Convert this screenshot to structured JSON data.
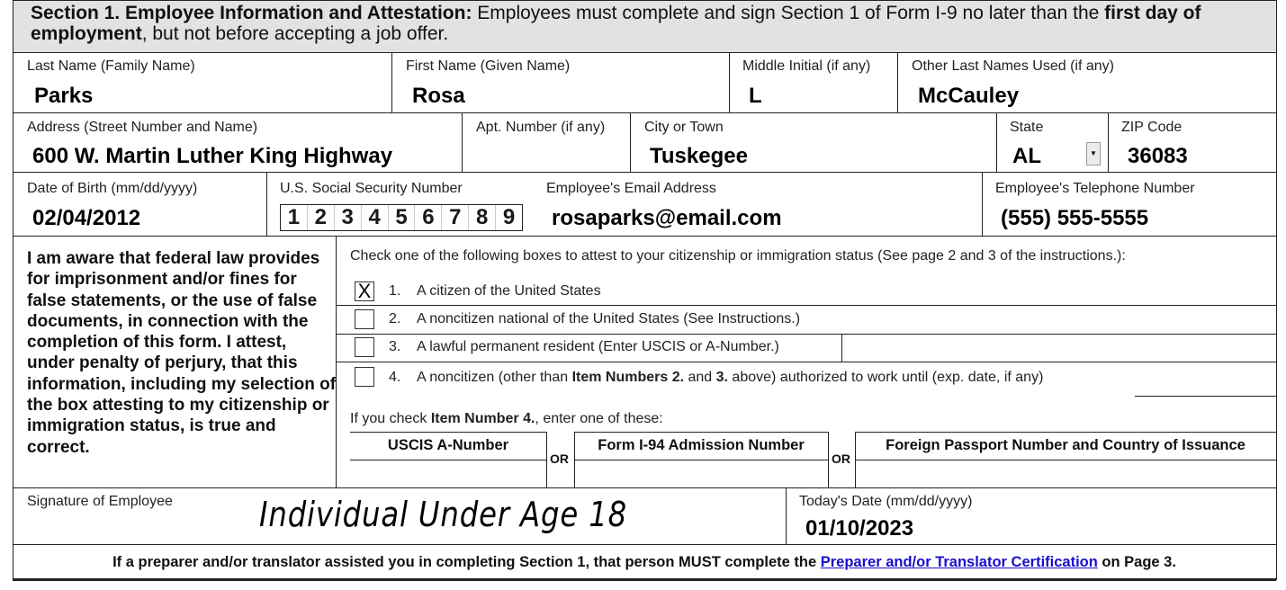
{
  "header": {
    "section_label": "Section 1. Employee Information and Attestation:",
    "text_pre": " Employees must complete and sign Section 1 of Form I-9 no later than the ",
    "bold_first": "first day of employment",
    "text_post": ", but not before accepting a job offer."
  },
  "fields": {
    "last_name": {
      "label": "Last Name (Family Name)",
      "value": "Parks"
    },
    "first_name": {
      "label": "First Name (Given Name)",
      "value": "Rosa"
    },
    "middle_initial": {
      "label": "Middle Initial (if any)",
      "value": "L"
    },
    "other_last_names": {
      "label": "Other Last Names Used (if any)",
      "value": "McCauley"
    },
    "address": {
      "label": "Address (Street Number and Name)",
      "value": "600 W. Martin Luther King Highway"
    },
    "apt_number": {
      "label": "Apt. Number (if any)",
      "value": ""
    },
    "city": {
      "label": "City or Town",
      "value": "Tuskegee"
    },
    "state": {
      "label": "State",
      "value": "AL",
      "dropdown_icon": "chevron-down-icon"
    },
    "zip": {
      "label": "ZIP Code",
      "value": "36083"
    },
    "dob": {
      "label": "Date of Birth (mm/dd/yyyy)",
      "value": "02/04/2012"
    },
    "ssn": {
      "label": "U.S. Social Security Number",
      "digits": [
        "1",
        "2",
        "3",
        "4",
        "5",
        "6",
        "7",
        "8",
        "9"
      ]
    },
    "email": {
      "label": "Employee's Email Address",
      "value": "rosaparks@email.com"
    },
    "phone": {
      "label": "Employee's Telephone Number",
      "value": "(555) 555-5555"
    }
  },
  "attestation": {
    "text": "I am aware that federal law provides for imprisonment and/or fines for false statements, or the use of false documents, in connection with the completion of this form.  I attest, under penalty of perjury, that this information, including my selection of the box attesting to my citizenship or immigration status, is true and correct.",
    "instruction": "Check one of the following boxes to attest to your citizenship or immigration status (See page 2 and 3 of the instructions.):",
    "options": [
      {
        "num": "1.",
        "text": "A citizen of the United States",
        "checked": true,
        "mark": "X"
      },
      {
        "num": "2.",
        "text": "A noncitizen national of the United States (See Instructions.)",
        "checked": false,
        "mark": ""
      },
      {
        "num": "3.",
        "text": "A lawful permanent resident (Enter USCIS or A-Number.)",
        "checked": false,
        "mark": ""
      },
      {
        "num": "4.",
        "text_pre": "A noncitizen (other than ",
        "bold1": "Item Numbers 2.",
        "text_mid": " and ",
        "bold2": "3.",
        "text_post": " above) authorized to work until (exp. date, if any)",
        "checked": false,
        "mark": ""
      }
    ],
    "item4_pre": "If you check ",
    "item4_bold": "Item Number 4.",
    "item4_post": ", enter one of these:",
    "doc_columns": [
      "USCIS A-Number",
      "Form I-94 Admission Number",
      "Foreign Passport Number and Country of Issuance"
    ],
    "or_label": "OR"
  },
  "signature": {
    "label": "Signature of Employee",
    "value": "Individual Under Age 18",
    "date_label": "Today's Date (mm/dd/yyyy)",
    "date_value": "01/10/2023"
  },
  "footer": {
    "text_pre": "If a preparer and/or translator assisted you in completing Section 1, that person MUST complete the ",
    "link": "Preparer and/or Translator Certification",
    "text_post": " on Page 3.",
    "link_color": "#1a0dcc"
  }
}
